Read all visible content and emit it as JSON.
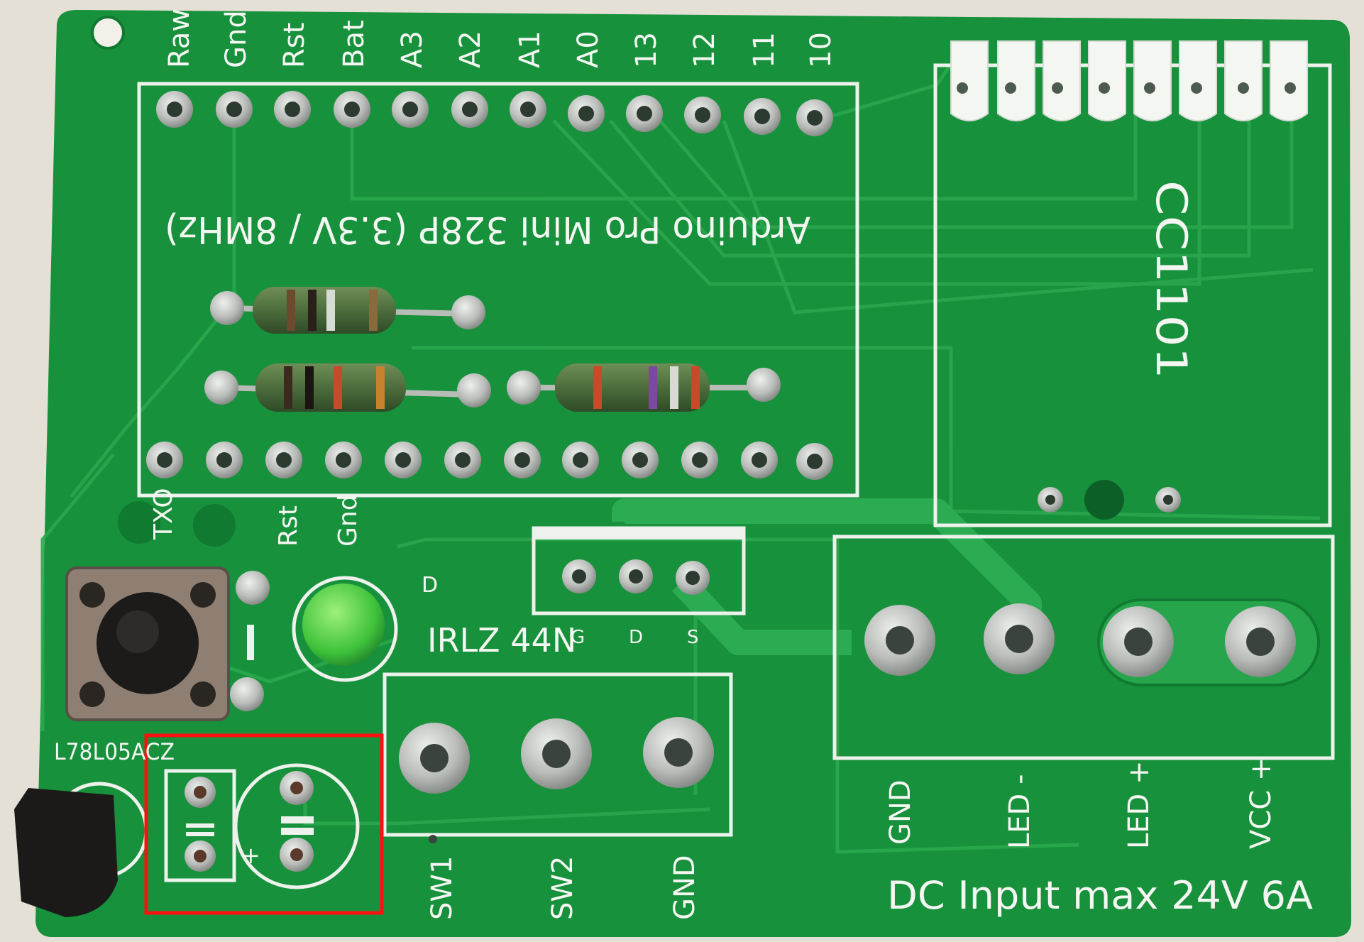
{
  "board": {
    "header_pin_labels": [
      "Raw",
      "Gnd",
      "Rst",
      "Bat",
      "A3",
      "A2",
      "A1",
      "A0",
      "13",
      "12",
      "11",
      "10"
    ],
    "module_label": "Arduino Pro Mini 328P (3.3V / 8MHz)",
    "radio_label": "CC1101",
    "lower_header_labels": [
      "TXO",
      "Rst",
      "Gnd"
    ],
    "regulator_label": "L78L05ACZ",
    "mosfet_label": "IRLZ 44N",
    "mosfet_pins": [
      "G",
      "D",
      "S"
    ],
    "led_marker": "D",
    "switch_terminal_labels": [
      "SW1",
      "SW2",
      "GND"
    ],
    "power_terminal_labels": [
      "GND",
      "LED -",
      "LED +",
      "VCC +"
    ],
    "input_rating": "DC Input max 24V 6A",
    "capacitor_polarity": "+"
  },
  "highlight": {
    "color": "#ff1010",
    "target": "regulator capacitor footprints"
  },
  "colors": {
    "pcb": "#15913a",
    "trace": "#1fa447",
    "silkscreen": "#f4f6f2",
    "pad": "#c9ccc8"
  }
}
